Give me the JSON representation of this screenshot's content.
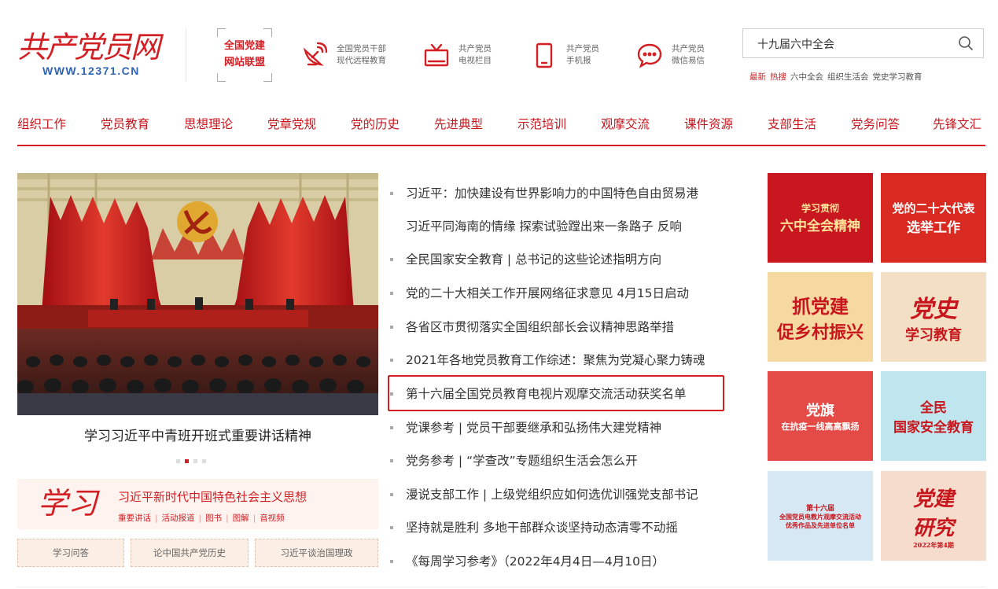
{
  "header": {
    "logo_text": "共产党员网",
    "logo_url": "WWW.12371.CN",
    "union_line1": "全国党建",
    "union_line2": "网站联盟",
    "items": [
      {
        "icon": "satellite-dish-icon",
        "line1": "全国党员干部",
        "line2": "现代远程教育"
      },
      {
        "icon": "tv-icon",
        "line1": "共产党员",
        "line2": "电视栏目"
      },
      {
        "icon": "mobile-phone-icon",
        "line1": "共产党员",
        "line2": "手机报"
      },
      {
        "icon": "chat-bubble-icon",
        "line1": "共产党员",
        "line2": "微信易信"
      }
    ],
    "search_value": "十九届六中全会",
    "hot": [
      "最新",
      "热搜",
      "六中全会",
      "组织生活会",
      "党史学习教育"
    ]
  },
  "nav": [
    "组织工作",
    "党员教育",
    "思想理论",
    "党章党规",
    "党的历史",
    "先进典型",
    "示范培训",
    "观摩交流",
    "课件资源",
    "支部生活",
    "党务问答",
    "先锋文汇"
  ],
  "feature": {
    "caption": "学习习近平中青班开班式重要讲话精神",
    "slides": 4,
    "active_slide": 2
  },
  "xuexi": {
    "calligraphy": "学习",
    "title": "习近平新时代中国特色社会主义思想",
    "links": [
      "重要讲话",
      "活动报道",
      "图书",
      "图解",
      "音视频"
    ]
  },
  "bottom_buttons": [
    "学习问答",
    "论中国共产党历史",
    "习近平谈治国理政"
  ],
  "news": [
    {
      "text": "习近平：加快建设有世界影响力的中国特色自由贸易港",
      "bullet": true
    },
    {
      "text": "习近平同海南的情缘   探索试验蹚出来一条路子   反响",
      "bullet": false
    },
    {
      "text": "全民国家安全教育 | 总书记的这些论述指明方向",
      "bullet": true
    },
    {
      "text": "党的二十大相关工作开展网络征求意见   4月15日启动",
      "bullet": true
    },
    {
      "text": "各省区市贯彻落实全国组织部长会议精神思路举措",
      "bullet": true
    },
    {
      "text": "2021年各地党员教育工作综述：聚焦为党凝心聚力铸魂",
      "bullet": true
    },
    {
      "text": "第十六届全国党员教育电视片观摩交流活动获奖名单",
      "bullet": true
    },
    {
      "text": "党课参考 | 党员干部要继承和弘扬伟大建党精神",
      "bullet": true
    },
    {
      "text": "党务参考 | “学查改”专题组织生活会怎么开",
      "bullet": true
    },
    {
      "text": "漫说支部工作 | 上级党组织应如何选优训强党支部书记",
      "bullet": true
    },
    {
      "text": "坚持就是胜利   多地干部群众谈坚持动态清零不动摇",
      "bullet": true
    },
    {
      "text": "《每周学习参考》（2022年4月4日—4月10日）",
      "bullet": true
    }
  ],
  "banners": [
    {
      "l1": "学习贯彻",
      "l2": "六中全会精神",
      "bg": "#c8171e",
      "fg": "#ffe29a"
    },
    {
      "l1": "党的二十大代表",
      "l2": "选举工作",
      "bg": "#d82a20",
      "fg": "#ffffff"
    },
    {
      "l1": "抓党建",
      "l2": "促乡村振兴",
      "bg": "#f6d9a0",
      "fg": "#c8161d"
    },
    {
      "l1": "党史",
      "l2": "学习教育",
      "bg": "#f3dfc4",
      "fg": "#c8161d"
    },
    {
      "l1": "党旗",
      "l2": "在抗疫一线高高飘扬",
      "bg": "#e44b47",
      "fg": "#ffffff"
    },
    {
      "l1": "全民",
      "l2": "国家安全教育",
      "bg": "#bfe6ef",
      "fg": "#c8161d"
    },
    {
      "l1": "第十六届",
      "l2": "全国党员电教片观摩交流活动",
      "l3": "优秀作品及先进单位名单",
      "bg": "#d6e8f3",
      "fg": "#c8161d"
    },
    {
      "l1": "党建",
      "l2": "研究",
      "l3": "2022年第4期",
      "bg": "#f6dccc",
      "fg": "#c8161d"
    }
  ]
}
